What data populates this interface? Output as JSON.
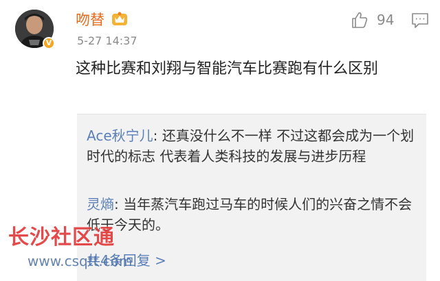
{
  "comment": {
    "username": "吻替",
    "timestamp": "5-27 14:37",
    "like_count": "94",
    "text": "这种比赛和刘翔与智能汽车比赛跑有什么区别"
  },
  "replies": [
    {
      "author": "Ace秋宁儿",
      "separator": ": ",
      "text": "还真没什么不一样 不过这都会成为一个划时代的标志 代表着人类科技的发展与进步历程"
    },
    {
      "author": "灵熵",
      "separator": ": ",
      "text": "当年蒸汽车跑过马车的时候人们的兴奋之情不会低于今天的。"
    }
  ],
  "view_more": "共4条回复 >",
  "watermark": {
    "title": "长沙社区通",
    "url": "www.csqtt.com"
  },
  "icons": {
    "like": "thumbs-up-icon",
    "comment": "comment-icon",
    "vip": "vip-crown-icon",
    "verified": "verified-badge-icon"
  },
  "colors": {
    "username": "#e86b1b",
    "reply_author": "#5a7fb8",
    "verified": "#f5a623",
    "reply_bg": "#f2f2f2",
    "watermark": "#e23b3b"
  }
}
